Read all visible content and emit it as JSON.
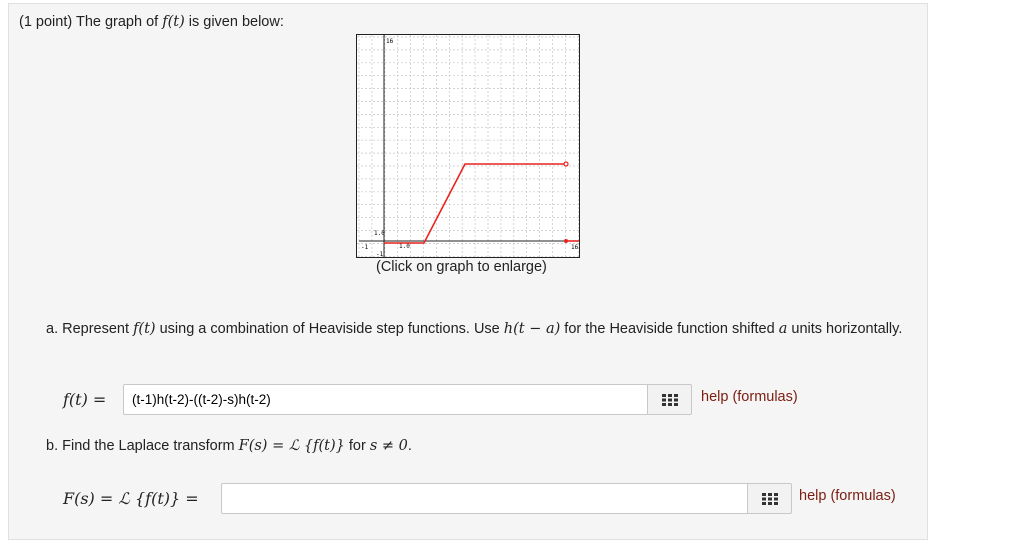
{
  "intro": {
    "prefix": "(1 point) The graph of ",
    "func": "f(t)",
    "suffix": " is given below:"
  },
  "graph": {
    "caption": "(Click on graph to enlarge)",
    "labels": {
      "ymax": "16",
      "ytick": "1.0",
      "xtick": "1.0",
      "xmin": "-1",
      "xmax": "16",
      "ymin": "-1"
    },
    "colors": {
      "line": "#e8231f",
      "axis": "#222222",
      "grid": "#b0b0b0"
    }
  },
  "part_a": {
    "prefix": "a. Represent ",
    "func": "f(t)",
    "middle": " using a combination of Heaviside step functions. Use ",
    "heaviside": "h(t − a)",
    "middle2": " for the Heaviside function shifted ",
    "var": "a",
    "suffix": " units horizontally.",
    "label": "f(t) =",
    "input_value": "(t-1)h(t-2)-((t-2)-s)h(t-2)",
    "help_label": "help (formulas)"
  },
  "part_b": {
    "prefix": "b. Find the Laplace transform ",
    "formula": "F(s) = ℒ {f(t)}",
    "middle": " for ",
    "condition": "s ≠ 0",
    "suffix": ".",
    "label": "F(s) = ℒ {f(t)} =",
    "input_value": "",
    "help_label": "help (formulas)"
  }
}
